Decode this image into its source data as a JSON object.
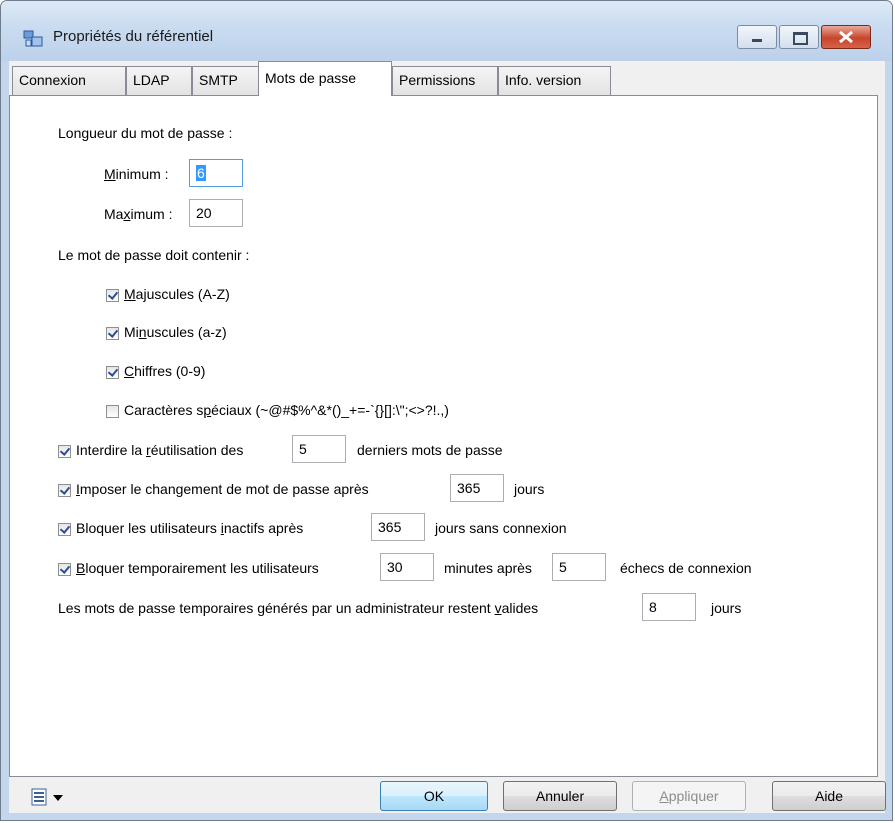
{
  "window": {
    "title": "Propriétés du référentiel"
  },
  "tabs": [
    {
      "label": "Connexion",
      "active": false
    },
    {
      "label": "LDAP",
      "active": false
    },
    {
      "label": "SMTP",
      "active": false
    },
    {
      "label": "Mots de passe",
      "active": true
    },
    {
      "label": "Permissions",
      "active": false
    },
    {
      "label": "Info. version",
      "active": false
    }
  ],
  "password": {
    "length_heading": "Longueur du mot de passe :",
    "min_label_pre": "",
    "min_label_u": "M",
    "min_label_post": "inimum :",
    "min_value": "6",
    "max_label_pre": "Ma",
    "max_label_u": "x",
    "max_label_post": "imum :",
    "max_value": "20",
    "contain_heading": "Le mot de passe doit contenir :",
    "upper": {
      "pre": "",
      "u": "M",
      "post": "ajuscules (A-Z)",
      "checked": true
    },
    "lower": {
      "pre": "Mi",
      "u": "n",
      "post": "uscules (a-z)",
      "checked": true
    },
    "digits": {
      "pre": "",
      "u": "C",
      "post": "hiffres (0-9)",
      "checked": true
    },
    "special": {
      "pre": "Caractères s",
      "u": "p",
      "post": "éciaux (~@#$%^&*()_+=-`{}[]:\\\";<>?!.,)",
      "checked": false
    }
  },
  "reuse": {
    "pre": "Interdire la ",
    "u": "r",
    "post": "éutilisation des",
    "value": "5",
    "suffix": "derniers mots de passe",
    "checked": true
  },
  "change": {
    "pre": "",
    "u": "I",
    "post": "mposer le changement de mot de passe après",
    "value": "365",
    "suffix": "jours",
    "checked": true
  },
  "inactive": {
    "pre": "Bloquer les utilisateurs ",
    "u": "i",
    "post": "nactifs après",
    "value": "365",
    "suffix": "jours sans connexion",
    "checked": true
  },
  "temp_block": {
    "pre": "",
    "u": "B",
    "post": "loquer temporairement les utilisateurs",
    "value": "30",
    "middle": "minutes après",
    "value2": "5",
    "suffix": "échecs de connexion",
    "checked": true
  },
  "temp_pwd": {
    "pre": "Les mots de passe temporaires générés par un administrateur restent ",
    "u": "v",
    "post": "alides",
    "value": "8",
    "suffix": "jours"
  },
  "buttons": {
    "ok": "OK",
    "cancel": "Annuler",
    "apply_u": "A",
    "apply_post": "ppliquer",
    "help": "Aide"
  }
}
